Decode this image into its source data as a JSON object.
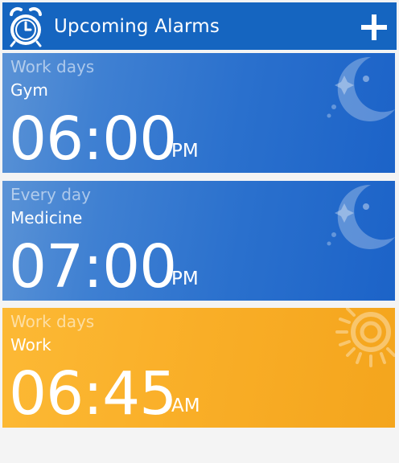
{
  "header": {
    "title": "Upcoming Alarms",
    "logo_icon": "alarm-clock-icon",
    "add_icon": "plus-icon"
  },
  "alarms": [
    {
      "repeat": "Work days",
      "label": "Gym",
      "time": "06:00",
      "ampm": "PM",
      "theme": "night",
      "icon": "moon-star-icon"
    },
    {
      "repeat": "Every day",
      "label": "Medicine",
      "time": "07:00",
      "ampm": "PM",
      "theme": "night",
      "icon": "moon-star-icon"
    },
    {
      "repeat": "Work days",
      "label": "Work",
      "time": "06:45",
      "ampm": "AM",
      "theme": "day",
      "icon": "sun-icon"
    }
  ],
  "colors": {
    "appbar": "#1565c0",
    "night_card": "#2a70cd",
    "day_card": "#f9ae27",
    "background": "#f4f4f4"
  }
}
